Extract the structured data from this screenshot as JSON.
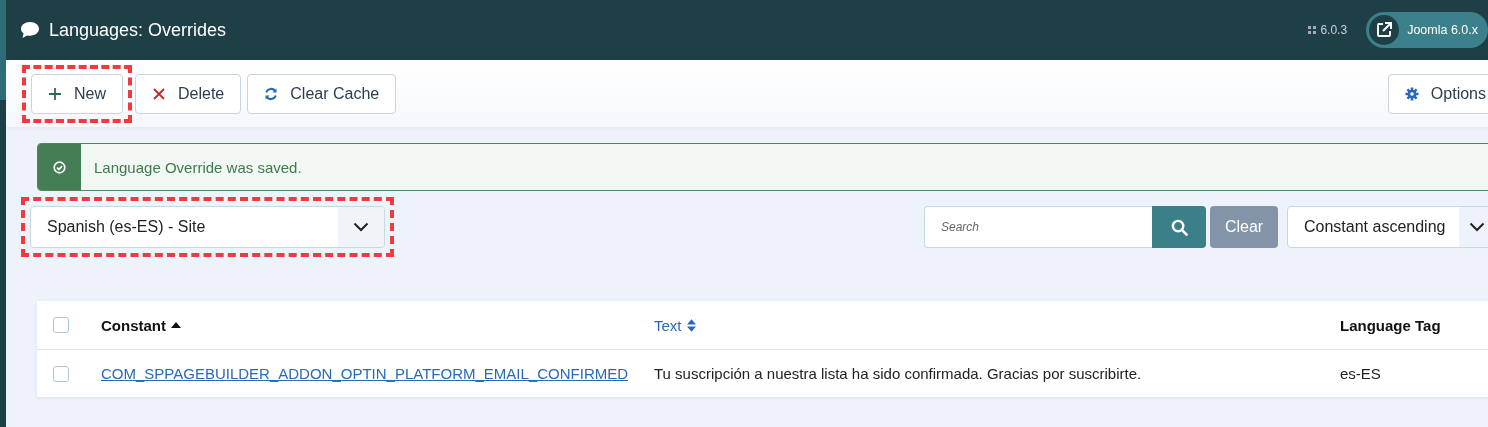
{
  "header": {
    "title": "Languages: Overrides",
    "version": "6.0.3",
    "site_link": "Joomla 6.0.x"
  },
  "toolbar": [
    {
      "kind": "new",
      "label": "New",
      "highlighted": true
    },
    {
      "kind": "delete",
      "label": "Delete",
      "highlighted": false
    },
    {
      "kind": "refresh",
      "label": "Clear Cache",
      "highlighted": false
    },
    {
      "kind": "options",
      "label": "Options",
      "highlighted": false
    }
  ],
  "alert": {
    "message": "Language Override was saved."
  },
  "language_select": {
    "value": "Spanish (es-ES) - Site",
    "highlighted": true
  },
  "search": {
    "placeholder": "Search",
    "clear": "Clear"
  },
  "sort_select": {
    "value": "Constant ascending"
  },
  "table": {
    "select_all_checked": false,
    "columns": [
      {
        "label": "Constant",
        "sorted_ascending": true,
        "sortable": false
      },
      {
        "label": "Text",
        "sorted_ascending": false,
        "sortable": true
      },
      {
        "label": "Language Tag",
        "sorted_ascending": false,
        "sortable": false
      }
    ],
    "rows": [
      {
        "checked": false,
        "constant": "COM_SPPAGEBUILDER_ADDON_OPTIN_PLATFORM_EMAIL_CONFIRMED",
        "text": "Tu suscripción a nuestra lista ha sido confirmada. Gracias por suscribirte.",
        "language_tag": "es-ES"
      }
    ]
  }
}
